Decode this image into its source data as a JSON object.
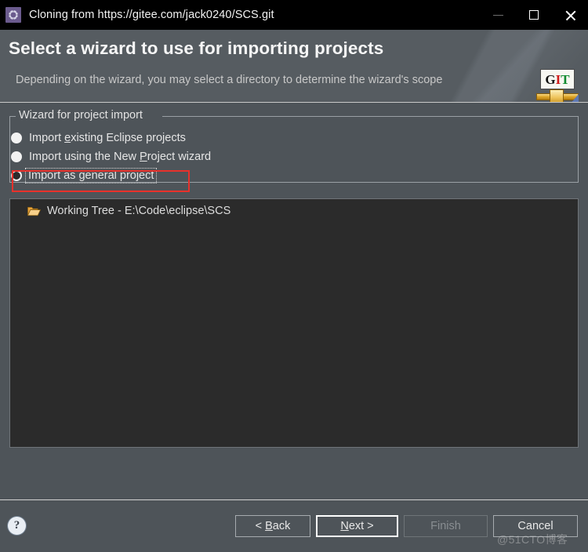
{
  "window": {
    "title": "Cloning from https://gitee.com/jack0240/SCS.git",
    "app_icon": "gear-icon",
    "controls": {
      "minimize": "minimize-icon",
      "maximize": "maximize-icon",
      "close": "close-icon"
    }
  },
  "header": {
    "title": "Select a wizard to use for importing projects",
    "subtitle": "Depending on the wizard, you may select a directory to determine the wizard's scope",
    "logo": {
      "name": "git-logo-icon",
      "letter_g": "G",
      "letter_i": "I",
      "letter_t": "T",
      "color_g": "#111111",
      "color_i": "#d01a1a",
      "color_t": "#0f8a2f"
    }
  },
  "group": {
    "legend": "Wizard for project import",
    "options": [
      {
        "label_before": "Import ",
        "mnemonic": "e",
        "label_after": "xisting Eclipse projects",
        "selected": false,
        "focused": false
      },
      {
        "label_before": "Import using the New ",
        "mnemonic": "P",
        "label_after": "roject wizard",
        "selected": false,
        "focused": false
      },
      {
        "label_before": "Import as ",
        "mnemonic": "g",
        "label_after": "eneral project",
        "selected": true,
        "focused": true
      }
    ]
  },
  "tree": {
    "items": [
      {
        "icon": "open-folder-icon",
        "label": "Working Tree - E:\\Code\\eclipse\\SCS"
      }
    ]
  },
  "footer": {
    "help_glyph": "?",
    "buttons": [
      {
        "id": "back",
        "text_before": "< ",
        "mnemonic": "B",
        "text_after": "ack",
        "state": "enabled"
      },
      {
        "id": "next",
        "text_before": "",
        "mnemonic": "N",
        "text_after": "ext >",
        "state": "default"
      },
      {
        "id": "finish",
        "text_before": "Finish",
        "mnemonic": "",
        "text_after": "",
        "state": "disabled"
      },
      {
        "id": "cancel",
        "text_before": "Cancel",
        "mnemonic": "",
        "text_after": "",
        "state": "enabled"
      }
    ]
  },
  "annotation": {
    "highlight_color": "#e8312b",
    "target": "Import as general project"
  },
  "watermark": "@51CTO博客",
  "colors": {
    "titlebar_bg": "#000000",
    "header_bg": "#565c61",
    "dialog_bg": "#4e5459",
    "tree_bg": "#2b2b2b",
    "text": "#e6e6e6"
  }
}
